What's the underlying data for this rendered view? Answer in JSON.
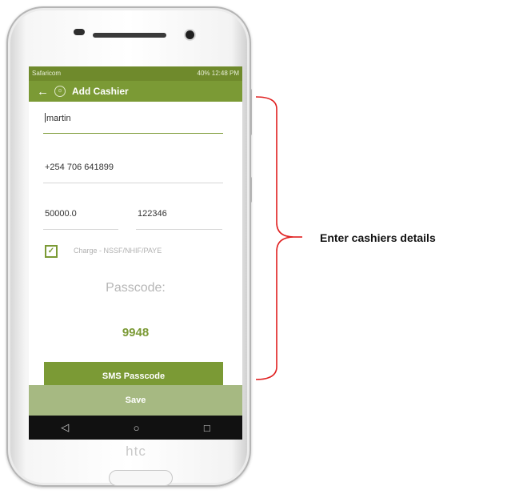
{
  "status_bar": {
    "carrier": "Safaricom",
    "right": "40%  12:48 PM"
  },
  "app_bar": {
    "back_icon": "arrow-left-icon",
    "app_icon": "app-logo-icon",
    "title": "Add Cashier"
  },
  "form": {
    "name_value": "martin",
    "phone_value": "+254 706 641899",
    "salary_value": "50000.0",
    "id_value": "122346",
    "charge_checked": true,
    "charge_label": "Charge - NSSF/NHIF/PAYE",
    "passcode_label": "Passcode:",
    "passcode_value": "9948",
    "sms_button_label": "SMS Passcode",
    "save_label": "Save"
  },
  "nav": {
    "back_glyph": "◁",
    "home_glyph": "○",
    "recents_glyph": "□"
  },
  "device": {
    "brand": "htc"
  },
  "annotation": {
    "text": "Enter cashiers details"
  },
  "colors": {
    "accent": "#7b9a35",
    "save_bar": "#a6b982",
    "bracket": "#e02020"
  }
}
